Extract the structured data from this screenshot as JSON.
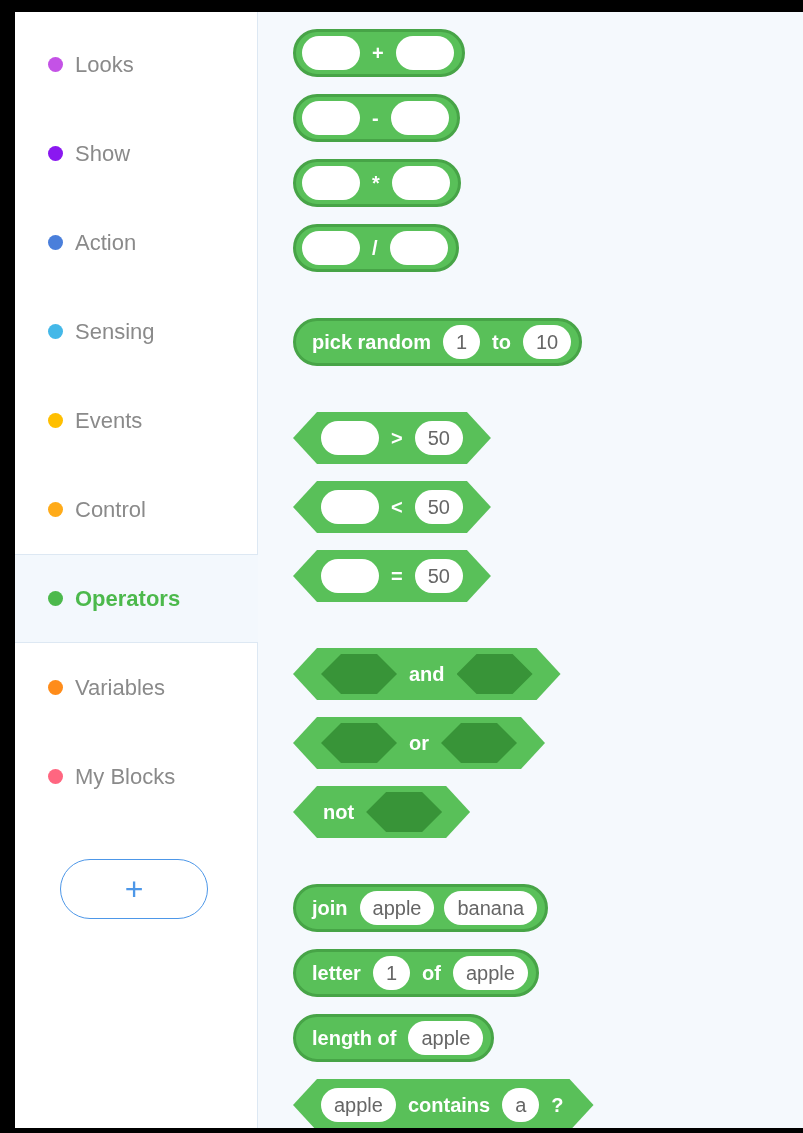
{
  "categories": [
    {
      "label": "Looks",
      "color": "#c452e6",
      "selected": false
    },
    {
      "label": "Show",
      "color": "#8a18f0",
      "selected": false
    },
    {
      "label": "Action",
      "color": "#4a7fdb",
      "selected": false
    },
    {
      "label": "Sensing",
      "color": "#44b8e8",
      "selected": false
    },
    {
      "label": "Events",
      "color": "#ffbf00",
      "selected": false
    },
    {
      "label": "Control",
      "color": "#ffab19",
      "selected": false
    },
    {
      "label": "Operators",
      "color": "#4cb94c",
      "selected": true
    },
    {
      "label": "Variables",
      "color": "#ff8c1a",
      "selected": false
    },
    {
      "label": "My Blocks",
      "color": "#ff6680",
      "selected": false
    }
  ],
  "add_button": {
    "label": "+"
  },
  "block_groups": [
    [
      {
        "kind": "reporter",
        "parts": [
          {
            "kind": "input"
          },
          {
            "kind": "text",
            "text": "+"
          },
          {
            "kind": "input"
          }
        ]
      },
      {
        "kind": "reporter",
        "parts": [
          {
            "kind": "input"
          },
          {
            "kind": "text",
            "text": "-"
          },
          {
            "kind": "input"
          }
        ]
      },
      {
        "kind": "reporter",
        "parts": [
          {
            "kind": "input"
          },
          {
            "kind": "text",
            "text": "*"
          },
          {
            "kind": "input"
          }
        ]
      },
      {
        "kind": "reporter",
        "parts": [
          {
            "kind": "input"
          },
          {
            "kind": "text",
            "text": "/"
          },
          {
            "kind": "input"
          }
        ]
      }
    ],
    [
      {
        "kind": "reporter",
        "parts": [
          {
            "kind": "text",
            "text": "pick random"
          },
          {
            "kind": "input",
            "text": "1"
          },
          {
            "kind": "text",
            "text": "to"
          },
          {
            "kind": "input",
            "text": "10"
          }
        ]
      }
    ],
    [
      {
        "kind": "boolean",
        "parts": [
          {
            "kind": "input"
          },
          {
            "kind": "text",
            "text": ">"
          },
          {
            "kind": "input",
            "text": "50"
          }
        ]
      },
      {
        "kind": "boolean",
        "parts": [
          {
            "kind": "input"
          },
          {
            "kind": "text",
            "text": "<"
          },
          {
            "kind": "input",
            "text": "50"
          }
        ]
      },
      {
        "kind": "boolean",
        "parts": [
          {
            "kind": "input"
          },
          {
            "kind": "text",
            "text": "="
          },
          {
            "kind": "input",
            "text": "50"
          }
        ]
      }
    ],
    [
      {
        "kind": "boolean",
        "parts": [
          {
            "kind": "slot"
          },
          {
            "kind": "text",
            "text": "and"
          },
          {
            "kind": "slot"
          }
        ]
      },
      {
        "kind": "boolean",
        "parts": [
          {
            "kind": "slot"
          },
          {
            "kind": "text",
            "text": "or"
          },
          {
            "kind": "slot"
          }
        ]
      },
      {
        "kind": "boolean",
        "parts": [
          {
            "kind": "text",
            "text": "not"
          },
          {
            "kind": "slot"
          }
        ]
      }
    ],
    [
      {
        "kind": "reporter",
        "parts": [
          {
            "kind": "text",
            "text": "join"
          },
          {
            "kind": "input",
            "text": "apple"
          },
          {
            "kind": "input",
            "text": "banana"
          }
        ]
      },
      {
        "kind": "reporter",
        "parts": [
          {
            "kind": "text",
            "text": "letter"
          },
          {
            "kind": "input",
            "text": "1"
          },
          {
            "kind": "text",
            "text": "of"
          },
          {
            "kind": "input",
            "text": "apple"
          }
        ]
      },
      {
        "kind": "reporter",
        "parts": [
          {
            "kind": "text",
            "text": "length of"
          },
          {
            "kind": "input",
            "text": "apple"
          }
        ]
      },
      {
        "kind": "boolean",
        "parts": [
          {
            "kind": "input",
            "text": "apple"
          },
          {
            "kind": "text",
            "text": "contains"
          },
          {
            "kind": "input",
            "text": "a"
          },
          {
            "kind": "text",
            "text": "?"
          }
        ]
      }
    ]
  ]
}
